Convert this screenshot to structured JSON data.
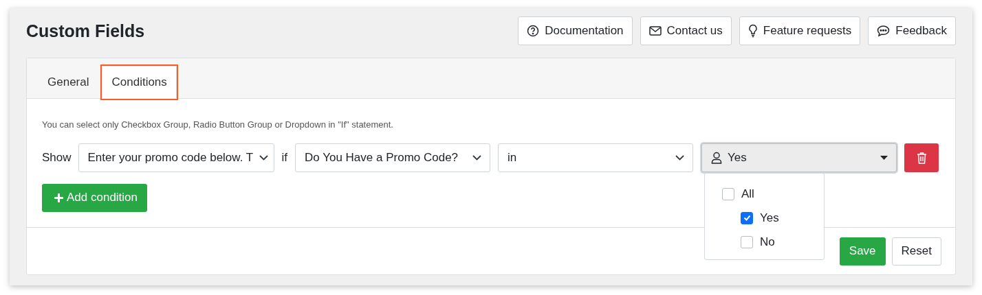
{
  "header": {
    "title": "Custom Fields",
    "buttons": [
      {
        "label": "Documentation",
        "kind": "help"
      },
      {
        "label": "Contact us",
        "kind": "mail"
      },
      {
        "label": "Feature requests",
        "kind": "idea"
      },
      {
        "label": "Feedback",
        "kind": "chat"
      }
    ]
  },
  "tabs": [
    {
      "label": "General",
      "selected": false,
      "highlighted": false
    },
    {
      "label": "Conditions",
      "selected": true,
      "highlighted": true
    }
  ],
  "hint": "You can select only Checkbox Group, Radio Button Group or Dropdown in \"If\" statement.",
  "condition": {
    "show_label": "Show",
    "field": "Enter your promo code below. T",
    "if_label": "if",
    "source": "Do You Have a Promo Code?",
    "operator": "in",
    "values": {
      "value": "Yes",
      "expanded": true,
      "options": [
        {
          "label": "All",
          "checked": false,
          "kind": "parent"
        },
        {
          "label": "Yes",
          "checked": true,
          "kind": "child"
        },
        {
          "label": "No",
          "checked": false,
          "kind": "child"
        }
      ]
    }
  },
  "add_button": "Add condition",
  "footer_buttons": [
    {
      "label": "Save",
      "kind": "primary"
    },
    {
      "label": "Reset",
      "kind": "secondary"
    }
  ]
}
